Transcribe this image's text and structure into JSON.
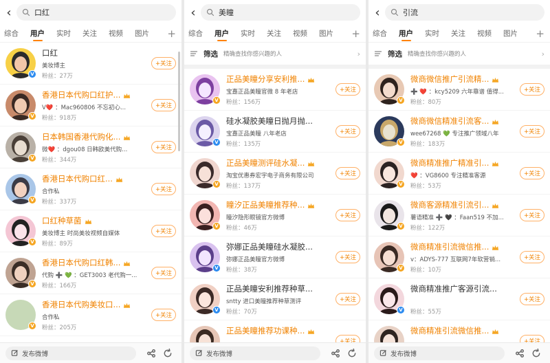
{
  "colors": {
    "accent": "#ff8200",
    "vip_name": "#f08200",
    "verified_gold": "#f5a623",
    "verified_blue": "#2d8cf0"
  },
  "icons": {
    "back": "chevron-left-icon",
    "search": "search-icon",
    "filter": "filter-icon",
    "crown": "crown-icon",
    "compose": "compose-icon",
    "share": "share-icon",
    "refresh": "refresh-icon"
  },
  "panels": [
    {
      "search_query": "口红",
      "tabs": [
        "综合",
        "用户",
        "实时",
        "关注",
        "视频",
        "图片"
      ],
      "active_tab": "用户",
      "results": [
        {
          "name": "口红",
          "desc": "美妆博主",
          "fans": "粉丝：27万",
          "follow": "+关注",
          "vip": false
        },
        {
          "name": "香港日本代购口红护...",
          "desc": "V❤️ ：Mac960806 不忘初心...",
          "fans": "粉丝：918万",
          "follow": "+关注",
          "vip": true
        },
        {
          "name": "日本韩国香港代购化...",
          "desc": "微❤️ ：dgou08 日韩欧美代购...",
          "fans": "粉丝：344万",
          "follow": "+关注",
          "vip": true
        },
        {
          "name": "香港日本代购口红...",
          "desc": "合作私",
          "fans": "粉丝：337万",
          "follow": "+关注",
          "vip": true
        },
        {
          "name": "口红种草菌",
          "desc": "美妆博主 时尚美妆视频自媒体",
          "fans": "粉丝：89万",
          "follow": "+关注",
          "vip": true
        },
        {
          "name": "香港日本代购口红韩...",
          "desc": "代购 ➕ 💚 ：GET3003 老代购一...",
          "fans": "粉丝：166万",
          "follow": "+关注",
          "vip": true
        },
        {
          "name": "香港日本代购美妆口...",
          "desc": "合作私",
          "fans": "粉丝：205万",
          "follow": "+关注",
          "vip": true
        }
      ],
      "compose_label": "发布微博"
    },
    {
      "search_query": "美瞳",
      "tabs": [
        "综合",
        "用户",
        "实时",
        "关注",
        "视频",
        "图片"
      ],
      "active_tab": "用户",
      "filter_label": "筛选",
      "filter_hint": "精确查找你感兴趣的人",
      "results": [
        {
          "name": "正品美瞳分享安利推...",
          "desc": "宝嘉正品美瞳官微 8 年老店",
          "fans": "粉丝：156万",
          "follow": "+关注",
          "vip": true
        },
        {
          "name": "硅水凝胶美瞳日抛月抛...",
          "desc": "宝嘉正品美瞳 八年老店",
          "fans": "粉丝：135万",
          "follow": "+关注",
          "vip": false
        },
        {
          "name": "正品美瞳测评硅水凝...",
          "desc": "淘宝优惠券宏宇电子商务有限公司",
          "fans": "粉丝：137万",
          "follow": "+关注",
          "vip": true
        },
        {
          "name": "瞳汐正品美瞳推荐种...",
          "desc": "瞳汐隐形眼镜官方微博",
          "fans": "粉丝：46万",
          "follow": "+关注",
          "vip": true
        },
        {
          "name": "弥娜正品美瞳硅水凝胶...",
          "desc": "弥娜正品美瞳官方微博",
          "fans": "粉丝：38万",
          "follow": "+关注",
          "vip": false
        },
        {
          "name": "正品美瞳安利推荐种草...",
          "desc": "sntty 进口美瞳推荐种草测评",
          "fans": "粉丝：70万",
          "follow": "+关注",
          "vip": false
        },
        {
          "name": "正品美瞳推荐功课种...",
          "desc": "",
          "fans": "",
          "follow": "+关注",
          "vip": true
        }
      ],
      "compose_label": "发布微博"
    },
    {
      "search_query": "引流",
      "tabs": [
        "综合",
        "用户",
        "实时",
        "关注",
        "视频",
        "图片"
      ],
      "active_tab": "用户",
      "filter_label": "筛选",
      "filter_hint": "精确查找你感兴趣的人",
      "results": [
        {
          "name": "微商微信推广引流精...",
          "desc": "➕ ❤️ ：kcy5209 六年靠谱 值得...",
          "fans": "粉丝：80万",
          "follow": "+关注",
          "vip": true
        },
        {
          "name": "微商微信精准引流客...",
          "desc": "wee67268 💚 专注推广领域八年",
          "fans": "粉丝：183万",
          "follow": "+关注",
          "vip": true
        },
        {
          "name": "微商精准推广精准引...",
          "desc": "❤️ ：VG8600 专注精准客源",
          "fans": "粉丝：53万",
          "follow": "+关注",
          "vip": true
        },
        {
          "name": "微商客源精准引流引...",
          "desc": "薯语精准 ➕ 🖤 ：Faan519 不加...",
          "fans": "粉丝：122万",
          "follow": "+关注",
          "vip": true
        },
        {
          "name": "微商精准引流微信推...",
          "desc": "v：ADYS-777 互联网7年软营销...",
          "fans": "粉丝：10万",
          "follow": "+关注",
          "vip": true
        },
        {
          "name": "微商精准推广客源引流...",
          "desc": "",
          "fans": "粉丝：55万",
          "follow": "+关注",
          "vip": false
        },
        {
          "name": "微商精准引流微信推...",
          "desc": "",
          "fans": "",
          "follow": "+关注",
          "vip": true
        }
      ],
      "compose_label": "发布微博"
    }
  ]
}
